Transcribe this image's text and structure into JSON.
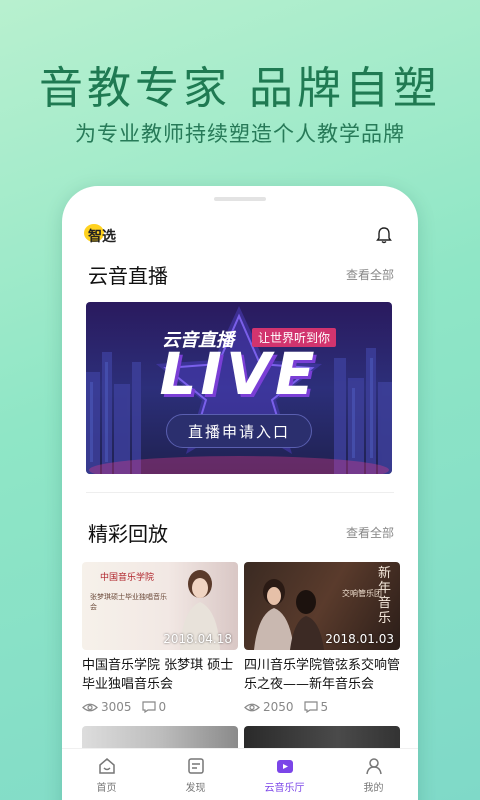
{
  "promo": {
    "title": "音教专家 品牌自塑",
    "subtitle": "为专业教师持续塑造个人教学品牌"
  },
  "header": {
    "logo_text": "智选",
    "logo_icon": "app-logo-icon",
    "notification_icon": "bell-icon"
  },
  "live_section": {
    "title": "云音直播",
    "see_all": "查看全部",
    "banner": {
      "brand": "云音直播",
      "slogan": "让世界听到你",
      "big_text": "LIVE",
      "cta": "直播申请入口"
    }
  },
  "replay_section": {
    "title": "精彩回放",
    "see_all": "查看全部",
    "videos": [
      {
        "date": "2018.04.18",
        "title": "中国音乐学院 张梦琪 硕士毕业独唱音乐会",
        "views": "3005",
        "comments": "0",
        "thumb_header": "中国音乐学院",
        "thumb_caption": "张梦琪硕士毕业独唱音乐会"
      },
      {
        "date": "2018.01.03",
        "title": "四川音乐学院管弦系交响管乐之夜——新年音乐会",
        "views": "2050",
        "comments": "5",
        "thumb_header": "新年音乐",
        "thumb_caption": "交响管乐团"
      }
    ]
  },
  "tabbar": {
    "items": [
      {
        "label": "首页",
        "icon": "home-icon"
      },
      {
        "label": "发现",
        "icon": "discover-icon"
      },
      {
        "label": "云音乐厅",
        "icon": "concert-hall-icon"
      },
      {
        "label": "我的",
        "icon": "profile-icon"
      }
    ],
    "active_index": 2
  },
  "colors": {
    "accent": "#7b45e8",
    "promo_text": "#1f7a52",
    "logo_yellow": "#ffd21f"
  }
}
